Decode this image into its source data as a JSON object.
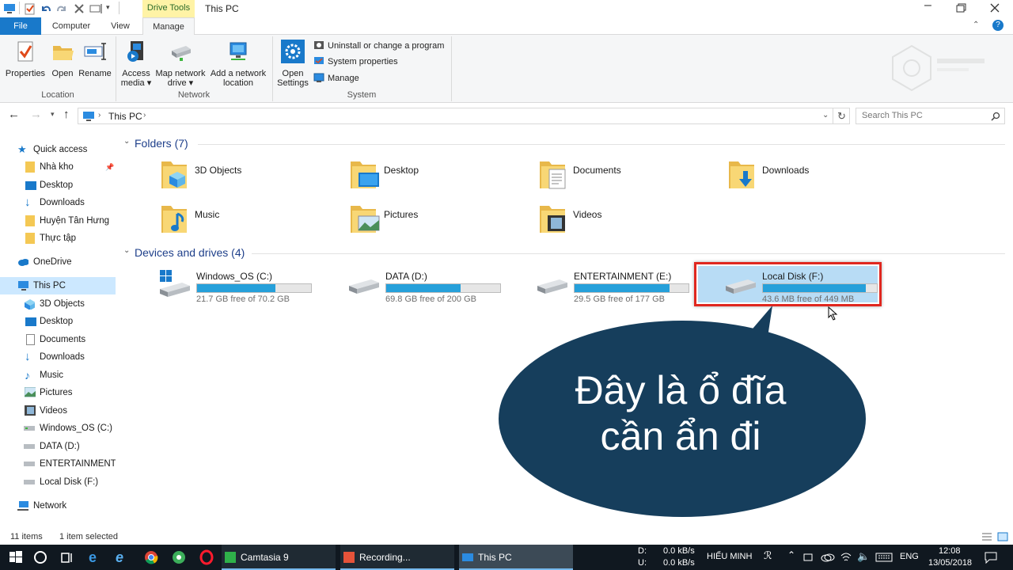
{
  "window": {
    "title": "This PC",
    "context_tab": "Drive Tools",
    "tabs": [
      "File",
      "Computer",
      "View",
      "Manage"
    ]
  },
  "ribbon": {
    "location_buttons": [
      "Properties",
      "Open",
      "Rename"
    ],
    "location_label": "Location",
    "network_buttons": [
      {
        "line1": "Access",
        "line2": "media ▾"
      },
      {
        "line1": "Map network",
        "line2": "drive ▾"
      },
      {
        "line1": "Add a network",
        "line2": "location"
      }
    ],
    "network_label": "Network",
    "system_open_settings": {
      "line1": "Open",
      "line2": "Settings"
    },
    "system_items": [
      "Uninstall or change a program",
      "System properties",
      "Manage"
    ],
    "system_label": "System"
  },
  "address": {
    "path": "This PC",
    "search_placeholder": "Search This PC"
  },
  "nav": {
    "quick_access": "Quick access",
    "quick_items": [
      "Nhà kho",
      "Desktop",
      "Downloads",
      "Huyện Tân Hưng",
      "Thực tập"
    ],
    "onedrive": "OneDrive",
    "this_pc": "This PC",
    "pc_items": [
      "3D Objects",
      "Desktop",
      "Documents",
      "Downloads",
      "Music",
      "Pictures",
      "Videos",
      "Windows_OS (C:)",
      "DATA (D:)",
      "ENTERTAINMENT (E:)",
      "Local Disk (F:)"
    ],
    "network": "Network"
  },
  "content": {
    "folders_header": "Folders (7)",
    "folders": [
      "3D Objects",
      "Desktop",
      "Documents",
      "Downloads",
      "Music",
      "Pictures",
      "Videos"
    ],
    "drives_header": "Devices and drives (4)",
    "drives": [
      {
        "name": "Windows_OS (C:)",
        "free": "21.7 GB free of 70.2 GB",
        "used_fraction": 0.69
      },
      {
        "name": "DATA (D:)",
        "free": "69.8 GB free of 200 GB",
        "used_fraction": 0.65
      },
      {
        "name": "ENTERTAINMENT (E:)",
        "free": "29.5 GB free of 177 GB",
        "used_fraction": 0.83
      },
      {
        "name": "Local Disk (F:)",
        "free": "43.6 MB free of 449 MB",
        "used_fraction": 0.9
      }
    ]
  },
  "callout": {
    "line1": "Đây là ổ đĩa",
    "line2": "cần ẩn đi"
  },
  "status": {
    "items": "11 items",
    "selected": "1 item selected"
  },
  "taskbar": {
    "apps": [
      "Camtasia 9",
      "Recording...",
      "This PC"
    ],
    "net_d_label": "D:",
    "net_u_label": "U:",
    "net_d": "0.0 kB/s",
    "net_u": "0.0 kB/s",
    "user": "HIẾU MINH",
    "lang": "ENG",
    "time": "12:08",
    "date": "13/05/2018"
  },
  "colors": {
    "accent": "#1979ca",
    "drive_fill": "#26a0da",
    "selection": "#cce8ff",
    "highlight_border": "#e0271f",
    "callout": "#163e5c"
  }
}
